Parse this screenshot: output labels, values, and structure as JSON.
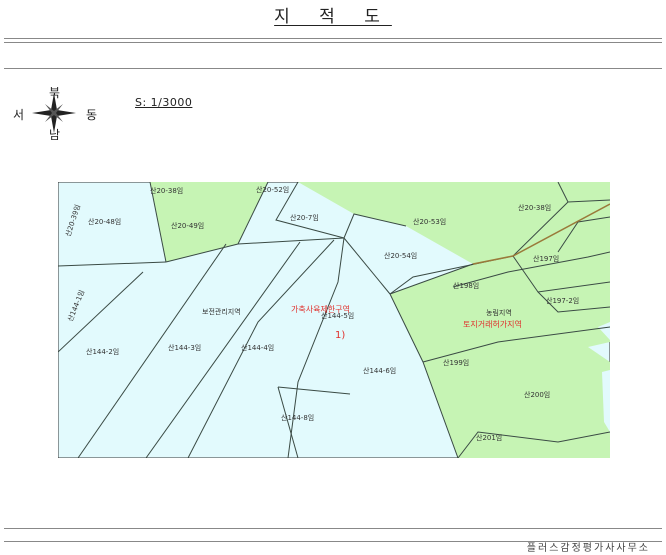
{
  "header": {
    "title": "지 적 도"
  },
  "compass": {
    "north": "북",
    "south": "남",
    "east": "동",
    "west": "서"
  },
  "scale": {
    "text": "S: 1/3000"
  },
  "map": {
    "parcels": [
      {
        "id": "p1",
        "label": "산20-38임"
      },
      {
        "id": "p2",
        "label": "산20-52임"
      },
      {
        "id": "p3",
        "label": "산20-39임"
      },
      {
        "id": "p4",
        "label": "산20-48임"
      },
      {
        "id": "p5",
        "label": "산20-49임"
      },
      {
        "id": "p6",
        "label": "산20-7임"
      },
      {
        "id": "p7",
        "label": "산20-53임"
      },
      {
        "id": "p8",
        "label": "산20-38임"
      },
      {
        "id": "p9",
        "label": "산20-54임"
      },
      {
        "id": "p10",
        "label": "산197임"
      },
      {
        "id": "p11",
        "label": "산198임"
      },
      {
        "id": "p12",
        "label": "산197-2임"
      },
      {
        "id": "p13",
        "label": "산144-1임"
      },
      {
        "id": "p14",
        "label": "산144-2임"
      },
      {
        "id": "p15",
        "label": "산144-3임"
      },
      {
        "id": "p16",
        "label": "산144-4임"
      },
      {
        "id": "p17",
        "label": "산144-5임"
      },
      {
        "id": "p18",
        "label": "산144-6임"
      },
      {
        "id": "p19",
        "label": "산144-8임"
      },
      {
        "id": "p20",
        "label": "산199임"
      },
      {
        "id": "p21",
        "label": "산200임"
      },
      {
        "id": "p22",
        "label": "산201임"
      }
    ],
    "zones": {
      "conservation": "보전관리지역",
      "livestock": "가축사육제한구역",
      "marker": "1)",
      "agri_forest": "농림지역",
      "land_permit": "토지거래허가지역"
    }
  },
  "footer": {
    "text": "플러스감정평가사사무소"
  },
  "colors": {
    "cyan": "#e2fafd",
    "green": "#c6f4b4",
    "line": "#3a4a44",
    "road": "#9a7a3a",
    "zone_text": "#e0302c"
  }
}
